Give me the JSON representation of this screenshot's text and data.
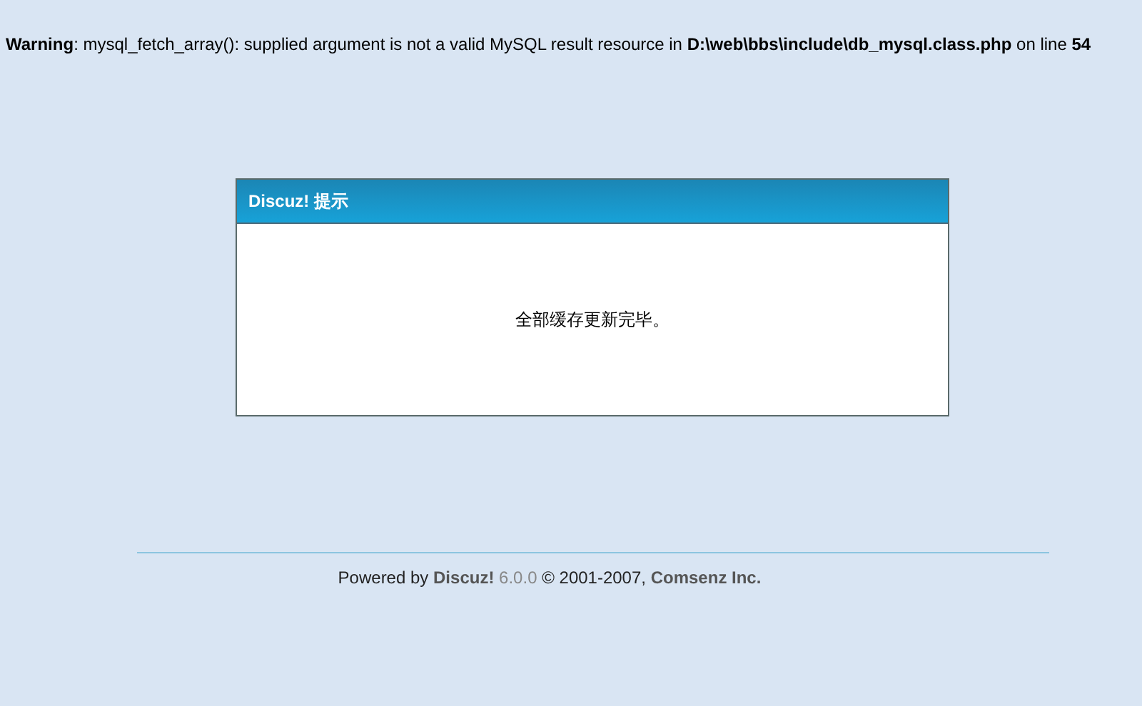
{
  "warning": "**Warning**: mysql_fetch_array(): supplied argument is not a valid MySQL result resource in **D:\\web\\bbs\\include\\db_mysql.class.php** on line **54**",
  "dialog": {
    "title": "Discuz! 提示",
    "message": "全部缓存更新完毕。"
  },
  "footer": [
    {
      "kind": "text",
      "text": "Powered by"
    },
    {
      "kind": "link",
      "text": "Discuz!"
    },
    {
      "kind": "version",
      "text": "6.0.0"
    },
    {
      "kind": "text",
      "text": "© 2001-2007,"
    },
    {
      "kind": "link",
      "text": "Comsenz Inc."
    }
  ]
}
